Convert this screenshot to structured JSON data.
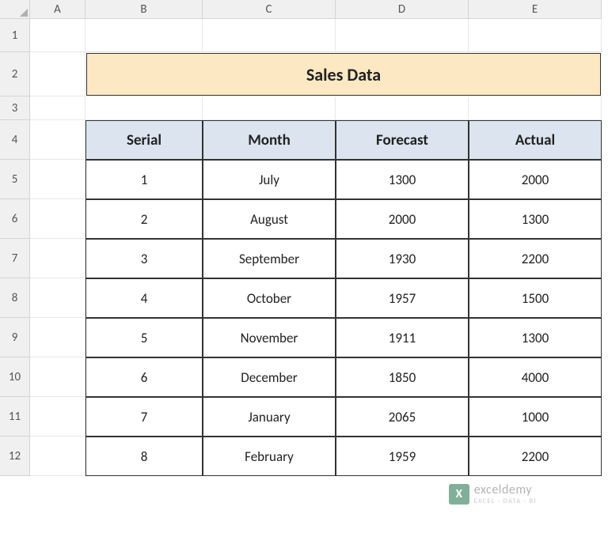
{
  "columns": [
    "A",
    "B",
    "C",
    "D",
    "E"
  ],
  "rows": [
    "1",
    "2",
    "3",
    "4",
    "5",
    "6",
    "7",
    "8",
    "9",
    "10",
    "11",
    "12"
  ],
  "title": "Sales Data",
  "table": {
    "headers": [
      "Serial",
      "Month",
      "Forecast",
      "Actual"
    ],
    "data": [
      [
        "1",
        "July",
        "1300",
        "2000"
      ],
      [
        "2",
        "August",
        "2000",
        "1300"
      ],
      [
        "3",
        "September",
        "1930",
        "2200"
      ],
      [
        "4",
        "October",
        "1957",
        "1500"
      ],
      [
        "5",
        "November",
        "1911",
        "1300"
      ],
      [
        "6",
        "December",
        "1850",
        "4000"
      ],
      [
        "7",
        "January",
        "2065",
        "1000"
      ],
      [
        "8",
        "February",
        "1959",
        "2200"
      ]
    ]
  },
  "watermark": {
    "icon_letter": "X",
    "brand": "exceldemy",
    "tagline": "EXCEL · DATA · BI"
  }
}
